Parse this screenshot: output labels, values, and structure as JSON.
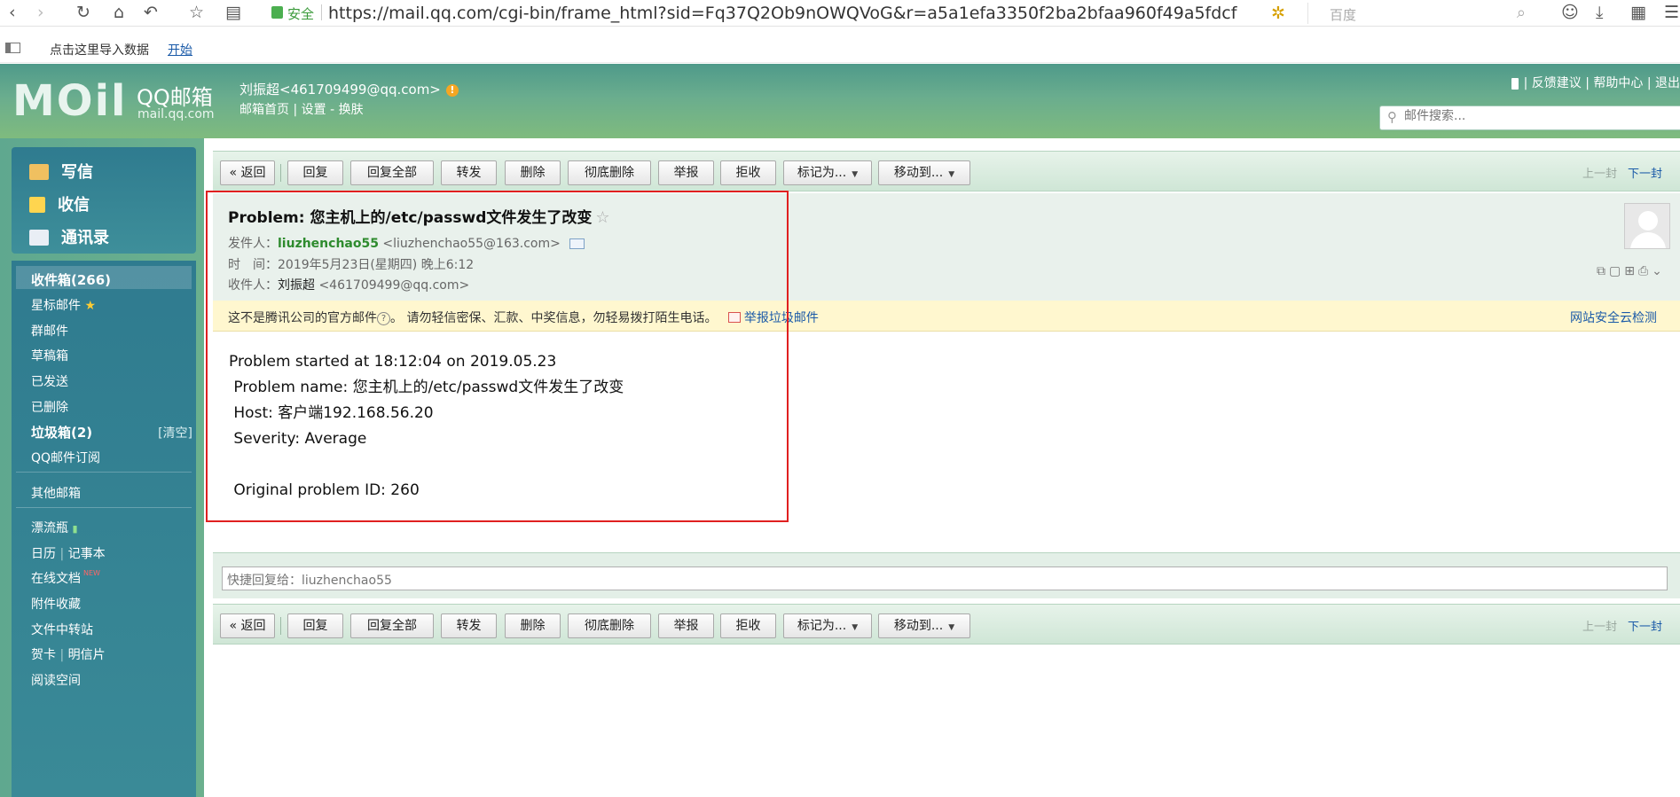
{
  "browser": {
    "secure_label": "安全",
    "url": "https://mail.qq.com/cgi-bin/frame_html?sid=Fq37Q2Ob9nOWQVoG&r=a5a1efa3350f2ba2bfaa960f49a5fdcf",
    "search_placeholder": "百度",
    "bookmark_text": "点击这里导入数据",
    "bookmark_link": "开始"
  },
  "header": {
    "logo_text": "MOil",
    "logo_qq": "QQ邮箱",
    "logo_domain": "mail.qq.com",
    "user": "刘振超<461709499@qq.com>",
    "user_links": "邮箱首页 | 设置 - 换肤",
    "top_links": "| 反馈建议 | 帮助中心 | 退出",
    "search_placeholder": "邮件搜索..."
  },
  "sidebar": {
    "compose": "写信",
    "inbox_action": "收信",
    "contacts": "通讯录",
    "folders": {
      "inbox": "收件箱(266)",
      "starred": "星标邮件",
      "group": "群邮件",
      "drafts": "草稿箱",
      "sent": "已发送",
      "deleted": "已删除",
      "spam": "垃圾箱(2)",
      "spam_clear": "[清空]",
      "subscriptions": "QQ邮件订阅",
      "other": "其他邮箱",
      "bottle": "漂流瓶",
      "calendar": "日历",
      "notes": "记事本",
      "docs": "在线文档",
      "docs_badge": "NEW",
      "attachments": "附件收藏",
      "transfer": "文件中转站",
      "cards": "贺卡",
      "postcards": "明信片",
      "reading": "阅读空间"
    }
  },
  "toolbar": {
    "back": "« 返回",
    "reply": "回复",
    "reply_all": "回复全部",
    "forward": "转发",
    "delete": "删除",
    "delete_forever": "彻底删除",
    "report": "举报",
    "reject": "拒收",
    "mark_as": "标记为...",
    "move_to": "移动到...",
    "prev": "上一封",
    "next": "下一封"
  },
  "mail": {
    "subject": "Problem: 您主机上的/etc/passwd文件发生了改变",
    "from_label": "发件人：",
    "from_name": "liuzhenchao55",
    "from_email": "<liuzhenchao55@163.com>",
    "time_label": "时　间：",
    "time": "2019年5月23日(星期四) 晚上6:12",
    "to_label": "收件人：",
    "to_name": "刘振超",
    "to_email": "<461709499@qq.com>",
    "warning": "这不是腾讯公司的官方邮件",
    "warning_tail": "。 请勿轻信密保、汇款、中奖信息，勿轻易拨打陌生电话。",
    "report_spam": "举报垃圾邮件",
    "cloud_check": "网站安全云检测",
    "body": "Problem started at 18:12:04 on 2019.05.23\n Problem name: 您主机上的/etc/passwd文件发生了改变\n Host: 客户端192.168.56.20\n Severity: Average\n\n Original problem ID: 260",
    "quick_reply_placeholder": "快捷回复给：liuzhenchao55"
  },
  "colors": {
    "highlight": "#e02020",
    "sidebar": "#2f7b8f",
    "header": "#6aad8e"
  }
}
